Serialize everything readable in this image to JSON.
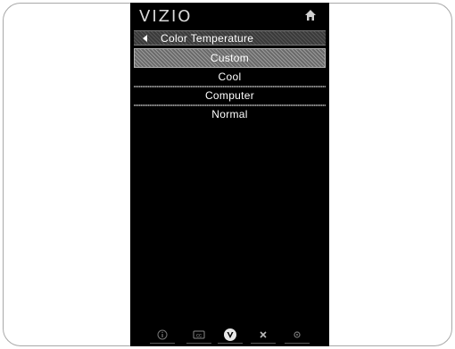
{
  "brand": {
    "logo_text": "VIZIO"
  },
  "title_bar": {
    "title": "Color Temperature"
  },
  "menu": {
    "items": [
      {
        "label": "Custom",
        "selected": true
      },
      {
        "label": "Cool",
        "selected": false
      },
      {
        "label": "Computer",
        "selected": false
      },
      {
        "label": "Normal",
        "selected": false
      }
    ]
  },
  "icons": {
    "home": "home-icon",
    "back": "chevron-left-icon",
    "bottom": [
      "info-icon",
      "cc-icon",
      "v-logo-icon",
      "close-icon",
      "settings-icon"
    ]
  },
  "colors": {
    "screen_bg": "#000000",
    "text": "#ffffff",
    "selected_bg": "#808080"
  }
}
